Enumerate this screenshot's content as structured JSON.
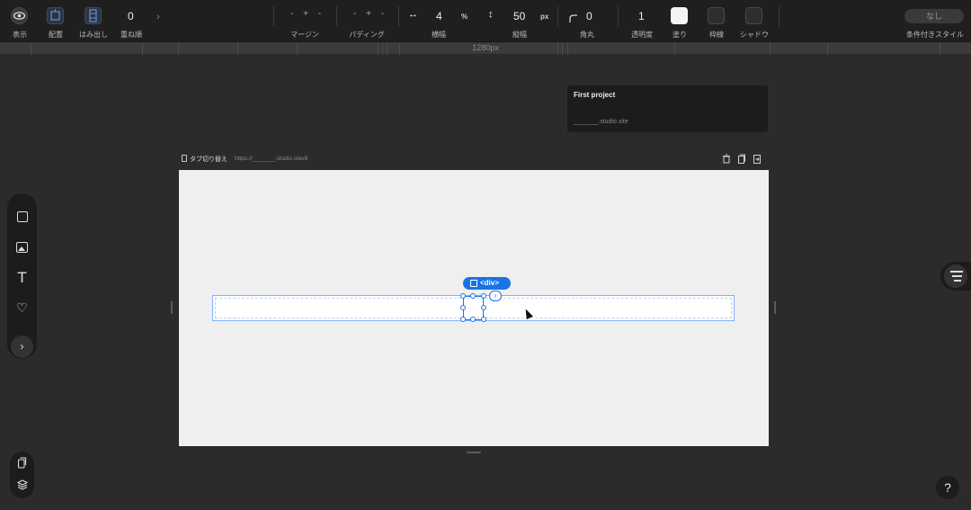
{
  "toolbar": {
    "view_label": "表示",
    "layout_label": "配置",
    "overflow_label": "はみ出し",
    "zorder_value": "0",
    "zorder_label": "重ね順",
    "expand_arrow": "›",
    "margin_label": "マージン",
    "margin_value": "- + -",
    "padding_label": "パディング",
    "padding_value": "- + -",
    "width_icon": "↔",
    "width_value": "4",
    "width_unit": "%",
    "width_label": "横幅",
    "height_icon": "↕",
    "height_value": "50",
    "height_unit": "px",
    "height_label": "縦幅",
    "radius_value": "0",
    "radius_label": "角丸",
    "opacity_value": "1",
    "opacity_label": "透明度",
    "fill_label": "塗り",
    "fill_color": "#f4f4f4",
    "border_label": "枠線",
    "shadow_label": "シャドウ",
    "condition_value": "なし",
    "condition_label": "条件付きスタイル"
  },
  "ruler": {
    "label": "1280px"
  },
  "project": {
    "title": "First project",
    "url": "_______.studio.site"
  },
  "canvas_header": {
    "tab_toggle_label": "タブ切り替え",
    "url": "https://_______.studio.site/8"
  },
  "selection": {
    "tag_label": "<div>",
    "next_symbol": "›"
  },
  "left_tools": {
    "text_tool": "T",
    "like_tool": "♡",
    "more_symbol": "›"
  },
  "help": {
    "label": "?"
  },
  "colors": {
    "accent": "#1a73e8",
    "canvas_bg": "#efefef",
    "app_bg": "#2b2b2b"
  }
}
